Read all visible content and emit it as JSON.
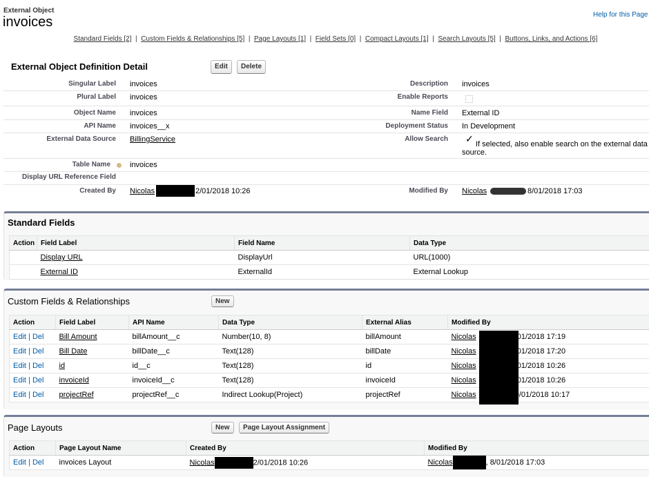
{
  "header": {
    "object_type": "External Object",
    "title": "invoices",
    "help_link": "Help for this Page"
  },
  "nav": [
    {
      "label": "Standard Fields",
      "count": "[2]"
    },
    {
      "label": "Custom Fields & Relationships",
      "count": "[5]"
    },
    {
      "label": "Page Layouts",
      "count": "[1]"
    },
    {
      "label": "Field Sets",
      "count": "[0]"
    },
    {
      "label": "Compact Layouts",
      "count": "[1]"
    },
    {
      "label": "Search Layouts",
      "count": "[5]"
    },
    {
      "label": "Buttons, Links, and Actions",
      "count": "[6]"
    }
  ],
  "detail": {
    "title": "External Object Definition Detail",
    "edit": "Edit",
    "delete": "Delete",
    "singular_label": {
      "label": "Singular Label",
      "value": "invoices"
    },
    "plural_label": {
      "label": "Plural Label",
      "value": "invoices"
    },
    "object_name": {
      "label": "Object Name",
      "value": "invoices"
    },
    "api_name": {
      "label": "API Name",
      "value": "invoices__x"
    },
    "external_data_source": {
      "label": "External Data Source",
      "value": "BillingService"
    },
    "table_name": {
      "label": "Table Name",
      "value": "invoices"
    },
    "display_url_ref": {
      "label": "Display URL Reference Field",
      "value": ""
    },
    "created_by": {
      "label": "Created By",
      "user": "Nicolas",
      "date": "2/01/2018 10:26"
    },
    "description": {
      "label": "Description",
      "value": "invoices"
    },
    "enable_reports": {
      "label": "Enable Reports",
      "checked": false
    },
    "name_field": {
      "label": "Name Field",
      "value": "External ID"
    },
    "deployment_status": {
      "label": "Deployment Status",
      "value": "In Development"
    },
    "allow_search": {
      "label": "Allow Search",
      "checked": true,
      "help": "If selected, also enable search on the external data source."
    },
    "modified_by": {
      "label": "Modified By",
      "user": "Nicolas",
      "date": "8/01/2018 17:03"
    }
  },
  "standard_fields": {
    "title": "Standard Fields",
    "columns": [
      "Action",
      "Field Label",
      "Field Name",
      "Data Type"
    ],
    "rows": [
      {
        "label": "Display URL",
        "name": "DisplayUrl",
        "type": "URL(1000)"
      },
      {
        "label": "External ID",
        "name": "ExternalId",
        "type": "External Lookup"
      }
    ]
  },
  "custom_fields": {
    "title": "Custom Fields & Relationships",
    "new": "New",
    "columns": [
      "Action",
      "Field Label",
      "API Name",
      "Data Type",
      "External Alias",
      "Modified By"
    ],
    "edit": "Edit",
    "del": "Del",
    "rows": [
      {
        "label": "Bill Amount",
        "api": "billAmount__c",
        "type": "Number(10, 8)",
        "alias": "billAmount",
        "user": "Nicolas",
        "date": "8/01/2018 17:19"
      },
      {
        "label": "Bill Date",
        "api": "billDate__c",
        "type": "Text(128)",
        "alias": "billDate",
        "user": "Nicolas",
        "date": "8/01/2018 17:20"
      },
      {
        "label": "id",
        "api": "id__c",
        "type": "Text(128)",
        "alias": "id",
        "user": "Nicolas",
        "date": "2/01/2018 10:26"
      },
      {
        "label": "invoiceId",
        "api": "invoiceId__c",
        "type": "Text(128)",
        "alias": "invoiceId",
        "user": "Nicolas",
        "date": "2/01/2018 10:26"
      },
      {
        "label": "projectRef",
        "api": "projectRef__c",
        "type": "Indirect Lookup(Project)",
        "alias": "projectRef",
        "user": "Nicolas",
        "date": "10/01/2018 10:17"
      }
    ]
  },
  "page_layouts": {
    "title": "Page Layouts",
    "new": "New",
    "assignment": "Page Layout Assignment",
    "columns": [
      "Action",
      "Page Layout Name",
      "Created By",
      "Modified By"
    ],
    "edit": "Edit",
    "del": "Del",
    "rows": [
      {
        "name": "invoices Layout",
        "created_user": "Nicolas",
        "created_date": "2/01/2018 10:26",
        "modified_user": "Nicolas",
        "modified_date": ", 8/01/2018 17:03"
      }
    ]
  }
}
